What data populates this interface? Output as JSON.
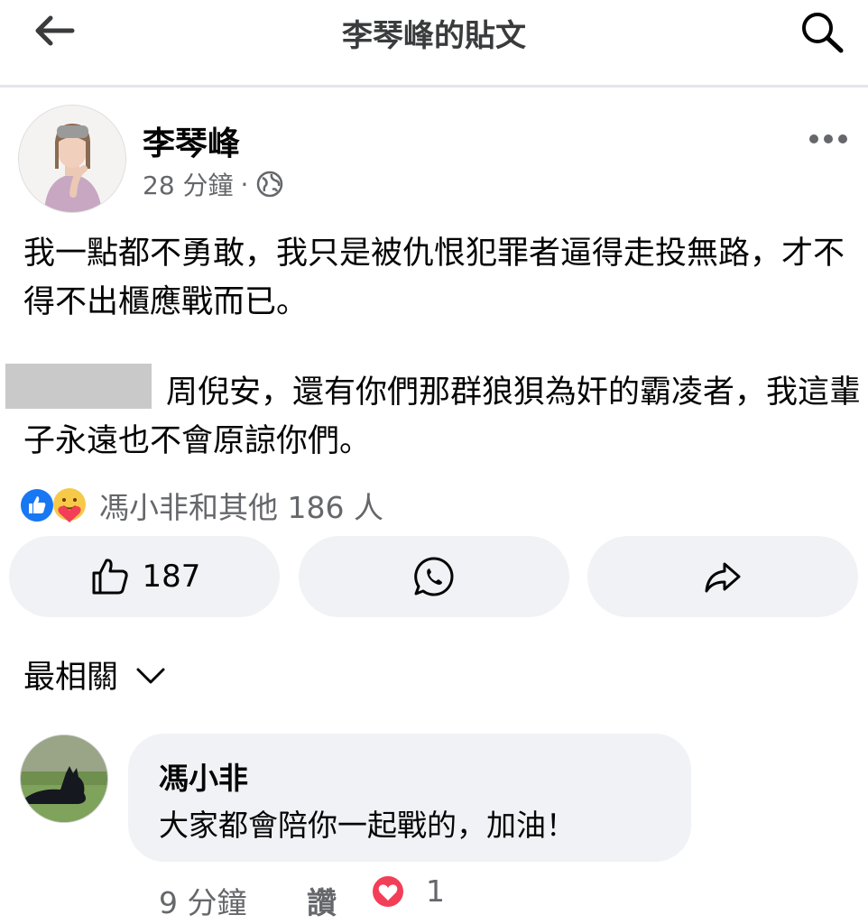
{
  "topbar": {
    "title": "李琴峰的貼文"
  },
  "post": {
    "author": "李琴峰",
    "time": "28 分鐘",
    "separator": "·",
    "paragraph1": "我一點都不勇敢，我只是被仇恨犯罪者逼得走投無路，才不得不出櫃應戰而已。",
    "paragraph2": "周倪安，還有你們那群狼狽為奸的霸凌者，我這輩子永遠也不會原諒你們。",
    "reactions_text": "馮小非和其他 186 人",
    "like_count": "187"
  },
  "sort": {
    "label": "最相關"
  },
  "comment": {
    "author": "馮小非",
    "text": "大家都會陪你一起戰的，加油！",
    "time": "9 分鐘",
    "like_label": "讚",
    "reaction_count": "1"
  },
  "colors": {
    "secondary_text": "#65676b",
    "button_bg": "#f0f2f5",
    "like_blue": "#1877f2",
    "love_red": "#f33e58"
  },
  "icons": [
    "back-arrow-icon",
    "search-icon",
    "globe-icon",
    "more-icon",
    "like-reaction-icon",
    "care-reaction-icon",
    "thumbs-up-icon",
    "whatsapp-icon",
    "share-icon",
    "chevron-down-icon",
    "heart-icon"
  ]
}
